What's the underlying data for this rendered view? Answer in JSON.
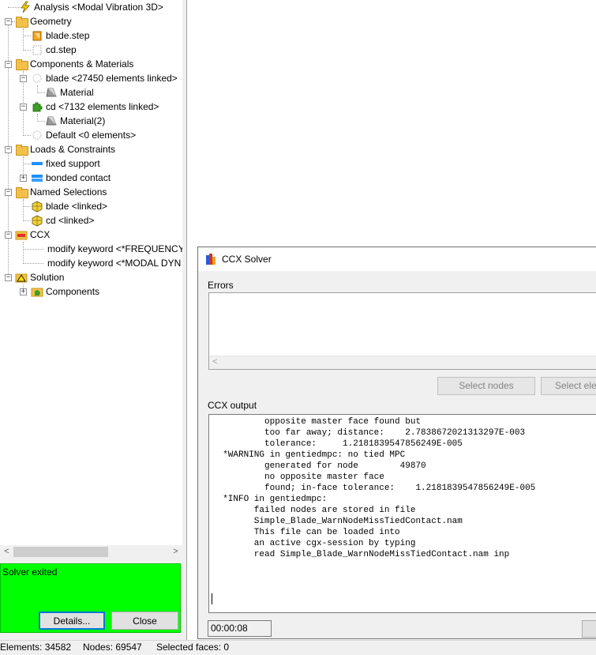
{
  "tree": {
    "analysis": "Analysis <Modal Vibration 3D>",
    "geometry": "Geometry",
    "blade_step": "blade.step",
    "cd_step": "cd.step",
    "components_materials": "Components & Materials",
    "blade_component": "blade <27450 elements linked>",
    "material": "Material",
    "cd_component": "cd <7132 elements linked>",
    "material2": "Material(2)",
    "default_component": "Default <0 elements>",
    "loads_constraints": "Loads & Constraints",
    "fixed_support": "fixed support",
    "bonded_contact": "bonded contact",
    "named_selections": "Named Selections",
    "blade_linked": "blade <linked>",
    "cd_linked": "cd <linked>",
    "ccx": "CCX",
    "modify_frequency": "modify keyword <*FREQUENCY,",
    "modify_modal": "modify keyword <*MODAL DYN",
    "solution": "Solution",
    "solution_components": "Components"
  },
  "status_box": {
    "text": "Solver exited",
    "details_label": "Details...",
    "close_label": "Close"
  },
  "status_bar": {
    "elements": "Elements: 34582",
    "nodes": "Nodes: 69547",
    "selected": "Selected faces: 0"
  },
  "dialog": {
    "title": "CCX Solver",
    "errors_label": "Errors",
    "select_nodes_label": "Select nodes",
    "select_elements_label": "Select ele",
    "output_label": "CCX output",
    "output_lines": "          opposite master face found but\n          too far away; distance:    2.7838672021313297E-003\n          tolerance:     1.2181839547856249E-005\n  *WARNING in gentiedmpc: no tied MPC\n          generated for node        49870\n          no opposite master face\n          found; in-face tolerance:    1.2181839547856249E-005\n  *INFO in gentiedmpc:\n        failed nodes are stored in file\n        Simple_Blade_WarnNodeMissTiedContact.nam\n        This file can be loaded into\n        an active cgx-session by typing\n        read Simple_Blade_WarnNodeMissTiedContact.nam inp",
    "timer": "00:00:08"
  },
  "colors": {
    "status_green": "#00ff00",
    "folder_yellow": "#f3c04a"
  }
}
